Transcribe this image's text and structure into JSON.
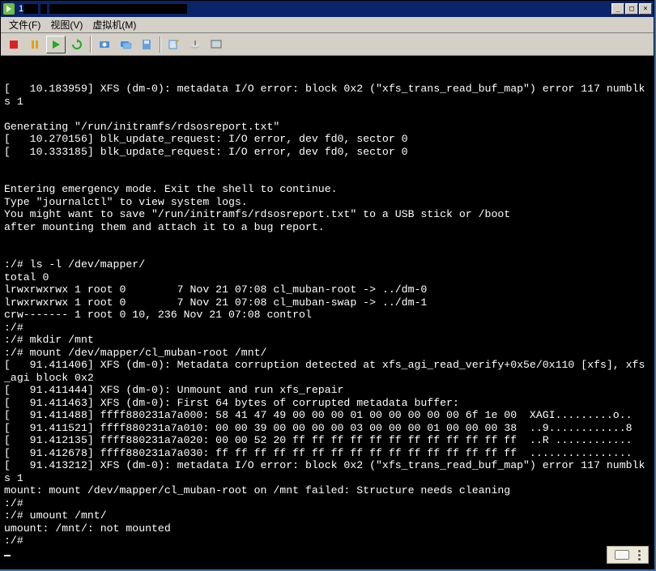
{
  "window": {
    "title_prefix": "1",
    "btn_min": "_",
    "btn_max": "□",
    "btn_close": "×"
  },
  "menu": {
    "file": "文件(F)",
    "view": "视图(V)",
    "vm": "虚拟机(M)"
  },
  "toolbar": {
    "stop": "stop",
    "pause": "pause",
    "play": "play",
    "reset": "reset",
    "snapshot": "snapshot",
    "snapshot_mgr": "snapshot-manager",
    "disk": "disk",
    "settings": "settings",
    "connect": "connect-device",
    "fullscreen": "fullscreen"
  },
  "console": {
    "lines": [
      "[   10.183959] XFS (dm-0): metadata I/O error: block 0x2 (\"xfs_trans_read_buf_map\") error 117 numblk",
      "s 1",
      "",
      "Generating \"/run/initramfs/rdsosreport.txt\"",
      "[   10.270156] blk_update_request: I/O error, dev fd0, sector 0",
      "[   10.333185] blk_update_request: I/O error, dev fd0, sector 0",
      "",
      "",
      "Entering emergency mode. Exit the shell to continue.",
      "Type \"journalctl\" to view system logs.",
      "You might want to save \"/run/initramfs/rdsosreport.txt\" to a USB stick or /boot",
      "after mounting them and attach it to a bug report.",
      "",
      "",
      ":/# ls -l /dev/mapper/",
      "total 0",
      "lrwxrwxrwx 1 root 0        7 Nov 21 07:08 cl_muban-root -> ../dm-0",
      "lrwxrwxrwx 1 root 0        7 Nov 21 07:08 cl_muban-swap -> ../dm-1",
      "crw------- 1 root 0 10, 236 Nov 21 07:08 control",
      ":/#",
      ":/# mkdir /mnt",
      ":/# mount /dev/mapper/cl_muban-root /mnt/",
      "[   91.411406] XFS (dm-0): Metadata corruption detected at xfs_agi_read_verify+0x5e/0x110 [xfs], xfs",
      "_agi block 0x2",
      "[   91.411444] XFS (dm-0): Unmount and run xfs_repair",
      "[   91.411463] XFS (dm-0): First 64 bytes of corrupted metadata buffer:",
      "[   91.411488] ffff880231a7a000: 58 41 47 49 00 00 00 01 00 00 00 00 00 6f 1e 00  XAGI.........o..",
      "[   91.411521] ffff880231a7a010: 00 00 39 00 00 00 00 03 00 00 00 01 00 00 00 38  ..9............8",
      "[   91.412135] ffff880231a7a020: 00 00 52 20 ff ff ff ff ff ff ff ff ff ff ff ff  ..R ............",
      "[   91.412678] ffff880231a7a030: ff ff ff ff ff ff ff ff ff ff ff ff ff ff ff ff  ................",
      "[   91.413212] XFS (dm-0): metadata I/O error: block 0x2 (\"xfs_trans_read_buf_map\") error 117 numblk",
      "s 1",
      "mount: mount /dev/mapper/cl_muban-root on /mnt failed: Structure needs cleaning",
      ":/#",
      ":/# umount /mnt/",
      "umount: /mnt/: not mounted",
      ":/# "
    ]
  }
}
